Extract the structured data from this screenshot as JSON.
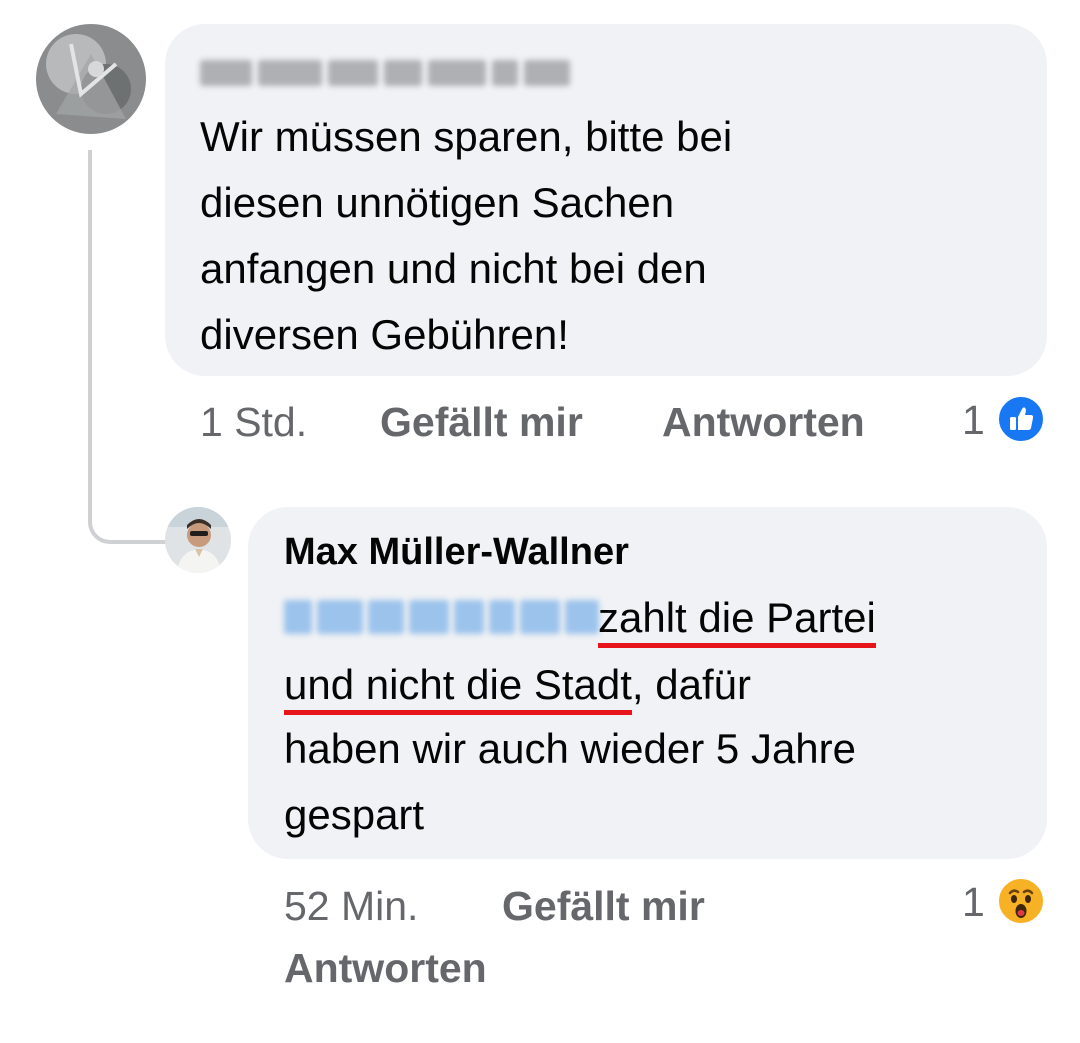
{
  "comment1": {
    "text_lines": [
      "Wir müssen sparen, bitte bei",
      "diesen unnötigen Sachen",
      "anfangen und nicht bei den",
      "diversen Gebühren!"
    ],
    "time": "1 Std.",
    "like_label": "Gefällt mir",
    "reply_label": "Antworten",
    "reaction_count": "1",
    "reaction_icon": "like-icon",
    "reaction_color": "#1877f2"
  },
  "reply": {
    "author": "Max Müller-Wallner",
    "line1_text": "zahlt die Partei",
    "line2_underlined": "und nicht die Stadt",
    "line2_rest": ", dafür",
    "line3": "haben wir auch wieder 5 Jahre",
    "line4": "gespart",
    "time": "52 Min.",
    "like_label": "Gefällt mir",
    "reply_label": "Antworten",
    "reaction_count": "1",
    "reaction_icon": "wow-icon",
    "reaction_color": "#f7b125",
    "underline_color": "#e8141c"
  }
}
